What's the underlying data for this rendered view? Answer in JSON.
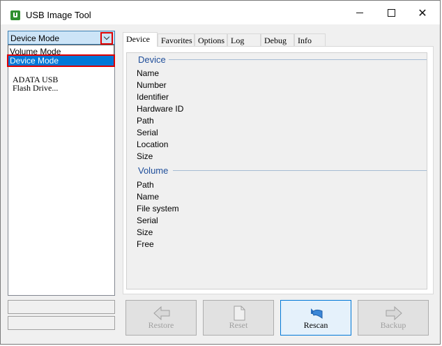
{
  "window": {
    "title": "USB Image Tool",
    "controls": {
      "minimize": "minimize",
      "maximize": "maximize",
      "close": "close"
    }
  },
  "mode_combo": {
    "selected": "Device Mode",
    "options": [
      "Volume Mode",
      "Device Mode"
    ]
  },
  "device_list": {
    "items": [
      {
        "line1": "ADATA USB",
        "line2": "Flash Drive..."
      }
    ]
  },
  "tabs": [
    "Device",
    "Favorites",
    "Options",
    "Log",
    "Debug",
    "Info"
  ],
  "device_section": {
    "title": "Device",
    "fields": [
      "Name",
      "Number",
      "Identifier",
      "Hardware ID",
      "Path",
      "Serial",
      "Location",
      "Size"
    ]
  },
  "volume_section": {
    "title": "Volume",
    "fields": [
      "Path",
      "Name",
      "File system",
      "Serial",
      "Size",
      "Free"
    ]
  },
  "buttons": {
    "restore": "Restore",
    "reset": "Reset",
    "rescan": "Rescan",
    "backup": "Backup"
  },
  "colors": {
    "accent": "#0078d7",
    "highlight_border": "#e00000",
    "section_title": "#1f4e9a"
  }
}
